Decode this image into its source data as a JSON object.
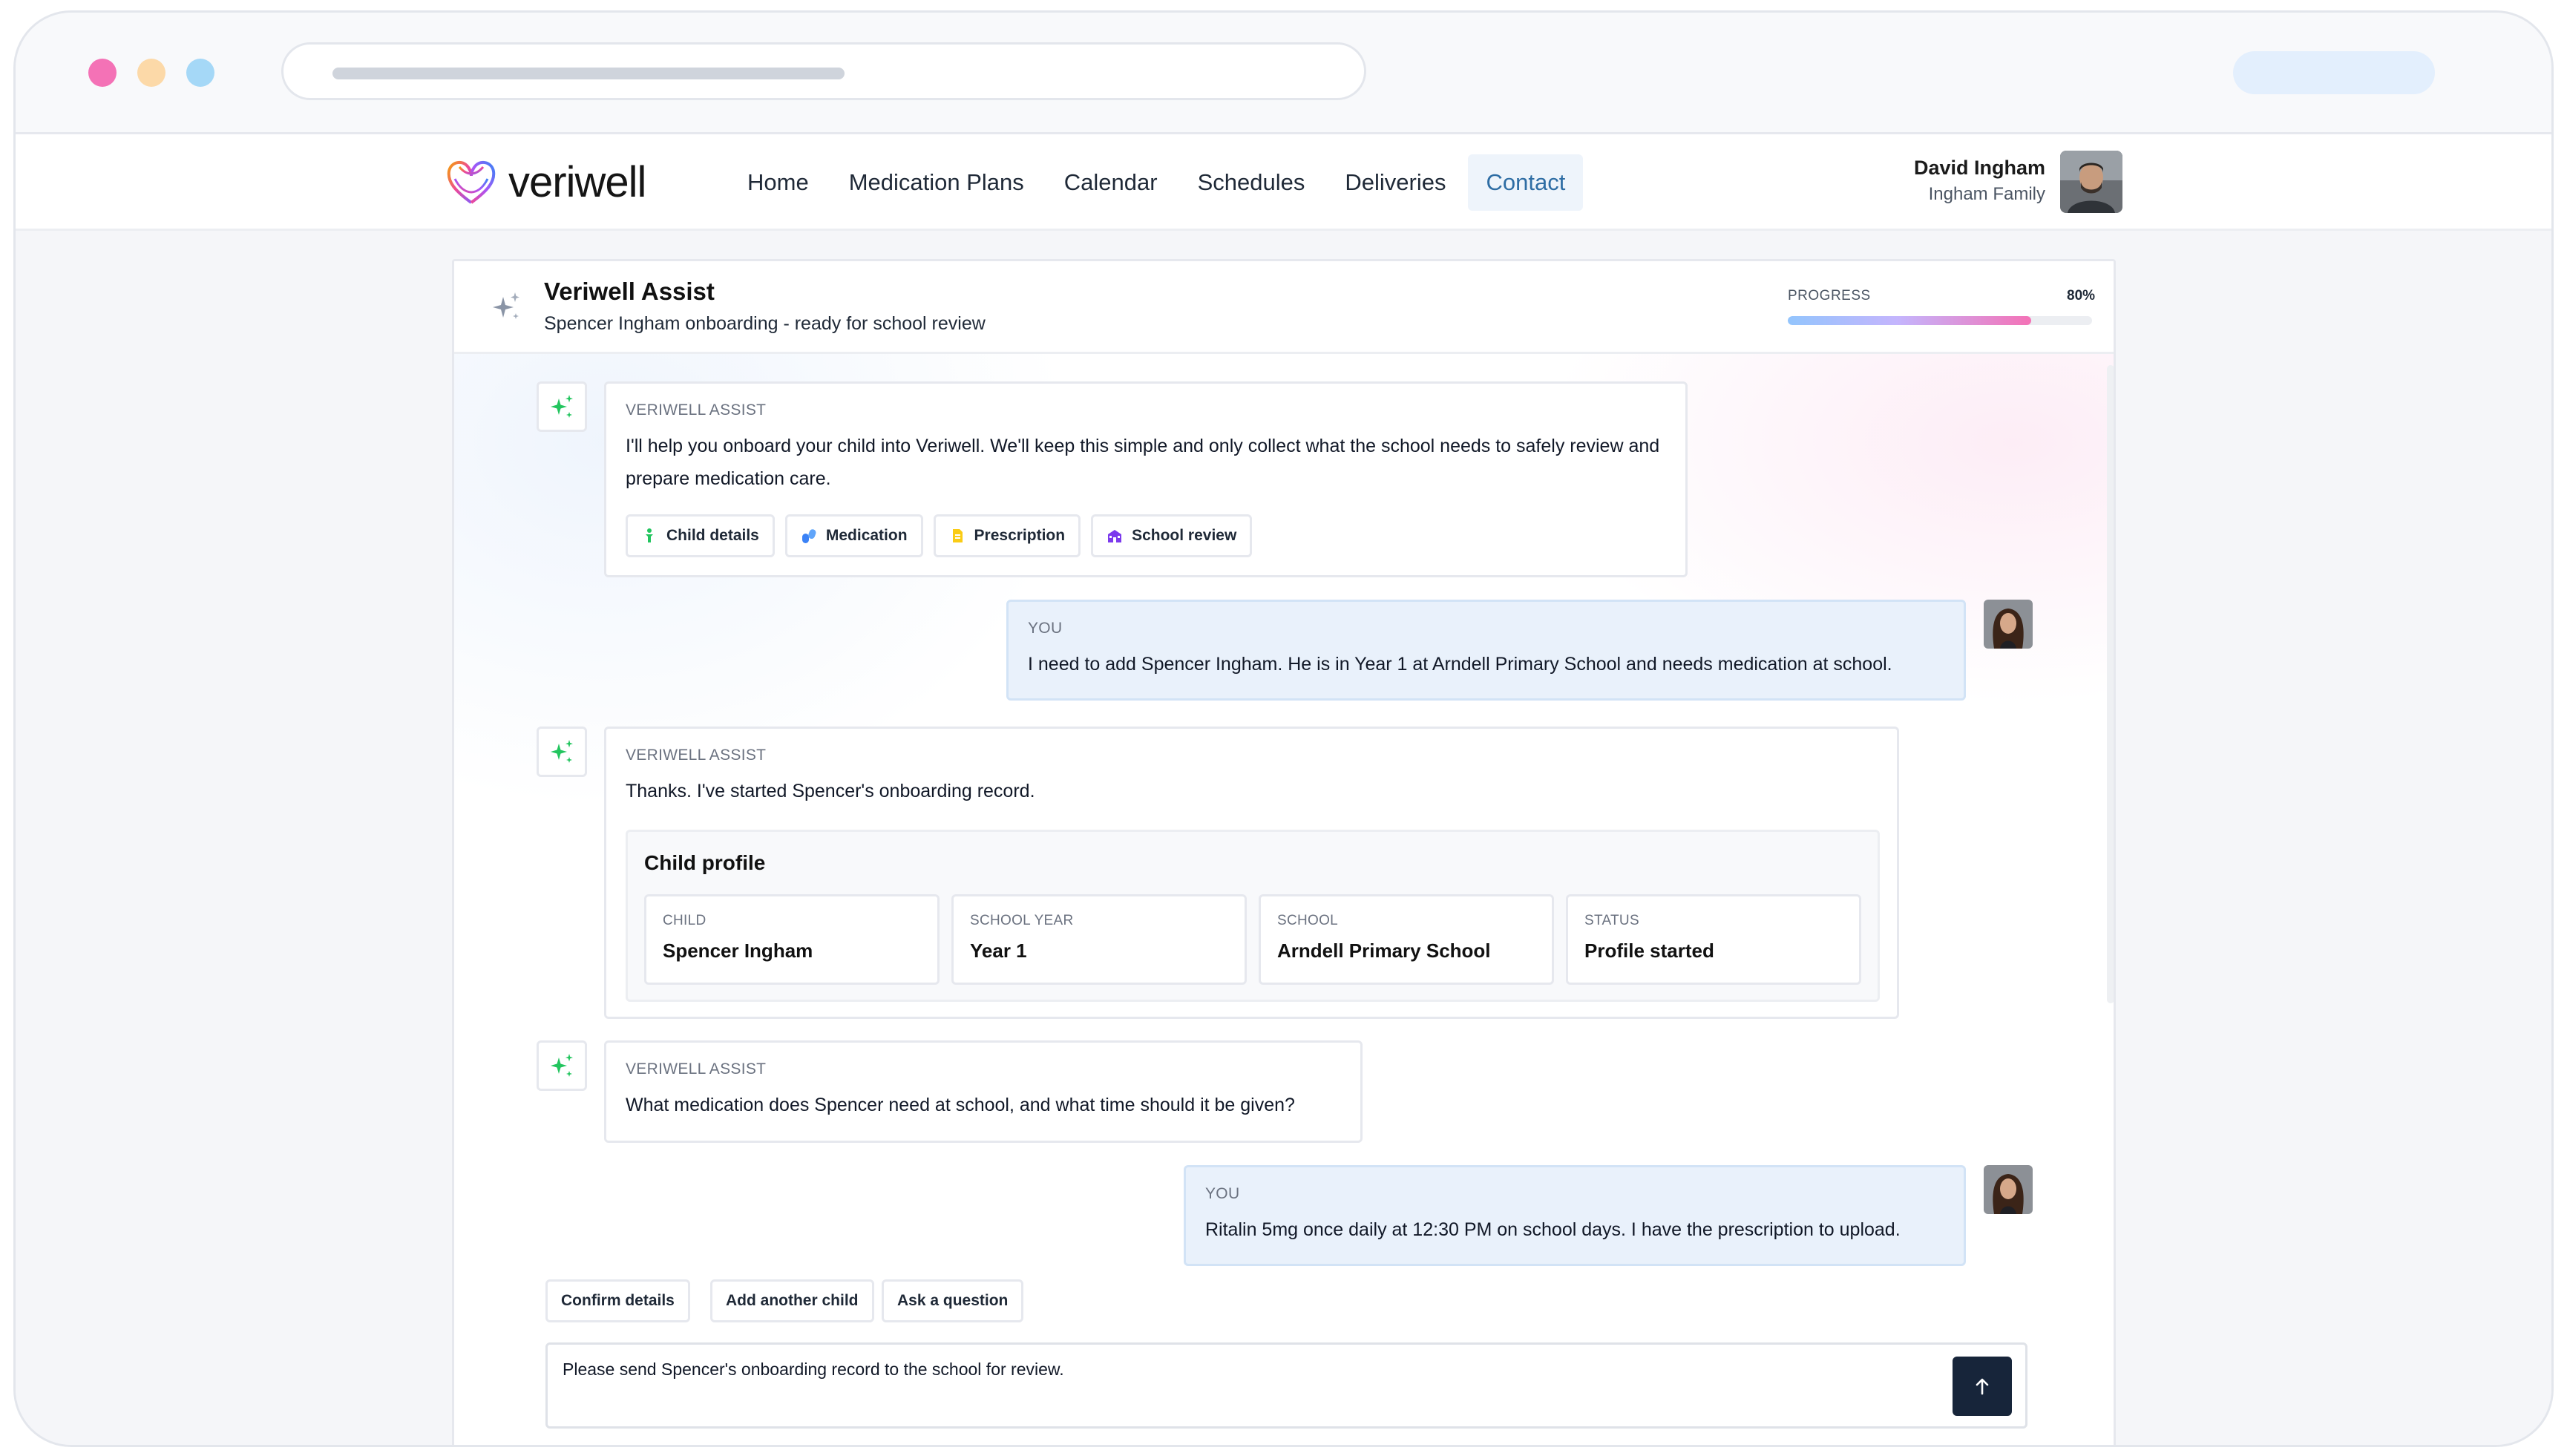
{
  "brand": {
    "name": "veriwell",
    "accent": "#2e6da4",
    "pink": "#f472b6"
  },
  "nav": {
    "links": [
      "Home",
      "Medication Plans",
      "Calendar",
      "Schedules",
      "Deliveries",
      "Contact"
    ],
    "active": "Contact"
  },
  "user": {
    "name": "David Ingham",
    "family": "Ingham Family"
  },
  "assistant": {
    "title": "Veriwell Assist",
    "subtitle": "Spencer Ingham onboarding - ready for school review",
    "progress_label": "PROGRESS",
    "progress_value": "80%",
    "progress_fraction": 0.8
  },
  "messages": {
    "m1": {
      "label": "VERIWELL ASSIST",
      "text": "I'll help you onboard your child into Veriwell. We'll keep this simple and only collect what the school needs to safely review and prepare medication care.",
      "chips": [
        {
          "label": "Child details",
          "icon": "child-icon"
        },
        {
          "label": "Medication",
          "icon": "pills-icon"
        },
        {
          "label": "Prescription",
          "icon": "document-icon"
        },
        {
          "label": "School review",
          "icon": "school-icon"
        }
      ]
    },
    "m2": {
      "label": "YOU",
      "text": "I need to add Spencer Ingham. He is in Year 1 at Arndell Primary School and needs medication at school."
    },
    "m3": {
      "label": "VERIWELL ASSIST",
      "text": "Thanks. I've started Spencer's onboarding record.",
      "card_title": "Child profile",
      "fields": [
        {
          "label": "CHILD",
          "value": "Spencer Ingham"
        },
        {
          "label": "SCHOOL YEAR",
          "value": "Year 1"
        },
        {
          "label": "SCHOOL",
          "value": "Arndell Primary School"
        },
        {
          "label": "STATUS",
          "value": "Profile started"
        }
      ]
    },
    "m4": {
      "label": "VERIWELL ASSIST",
      "text": "What medication does Spencer need at school, and what time should it be given?"
    },
    "m5": {
      "label": "YOU",
      "text": "Ritalin 5mg once daily at 12:30 PM on school days. I have the prescription to upload."
    }
  },
  "quick_replies": [
    "Confirm details",
    "Add another child",
    "Ask a question"
  ],
  "composer": {
    "value": "Please send Spencer's onboarding record to the school for review.",
    "send_icon": "arrow-up-icon"
  }
}
